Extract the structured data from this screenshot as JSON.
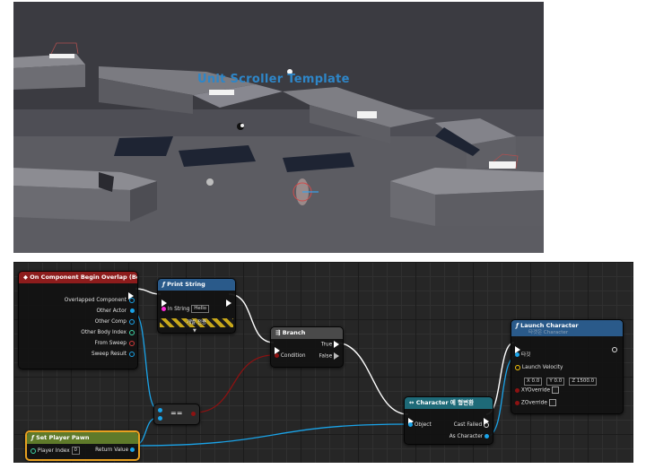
{
  "viewport": {
    "overlay_title": "Unit Scroller Template"
  },
  "nodes": {
    "overlap": {
      "title": "On Component Begin Overlap (Box)",
      "header_color": "#8d1c1c",
      "pins": [
        "Overlapped Component",
        "Other Actor",
        "Other Comp",
        "Other Body Index",
        "From Sweep",
        "Sweep Result"
      ]
    },
    "print": {
      "title": "Print String",
      "header_color": "#2a5a8a",
      "in_string_label": "In String",
      "in_string_value": "Hello",
      "dev_label": "개발 전용"
    },
    "branch": {
      "title": "Branch",
      "header_color": "#4a4a4a",
      "condition_label": "Condition",
      "true_label": "True",
      "false_label": "False"
    },
    "equal": {
      "label": "=="
    },
    "cast": {
      "title": "Character 에 형변환",
      "header_color": "#1e6a78",
      "object_label": "Object",
      "cast_failed_label": "Cast Failed",
      "as_character_label": "As Character"
    },
    "launch": {
      "title": "Launch Character",
      "subtitle": "타겟은 Character",
      "header_color": "#2a5a8a",
      "target_label": "타깃",
      "velocity_label": "Launch Velocity",
      "velocity": {
        "x": "X 0.0",
        "y": "Y 0.0",
        "z": "Z 1500.0"
      },
      "xy_override_label": "XYOverride",
      "z_override_label": "ZOverride"
    },
    "pawn": {
      "title": "Set Player Pawn",
      "header_color": "#5f7a2a",
      "player_index_label": "Player Index",
      "player_index_value": "0",
      "return_label": "Return Value"
    }
  },
  "colors": {
    "object_pin": "#1aa3e8",
    "bool_pin": "#8c1212",
    "int_pin": "#3ed6a6",
    "string_pin": "#ff2ad8",
    "vector_pin": "#f7c50a",
    "selected_outline": "#e8a020"
  }
}
